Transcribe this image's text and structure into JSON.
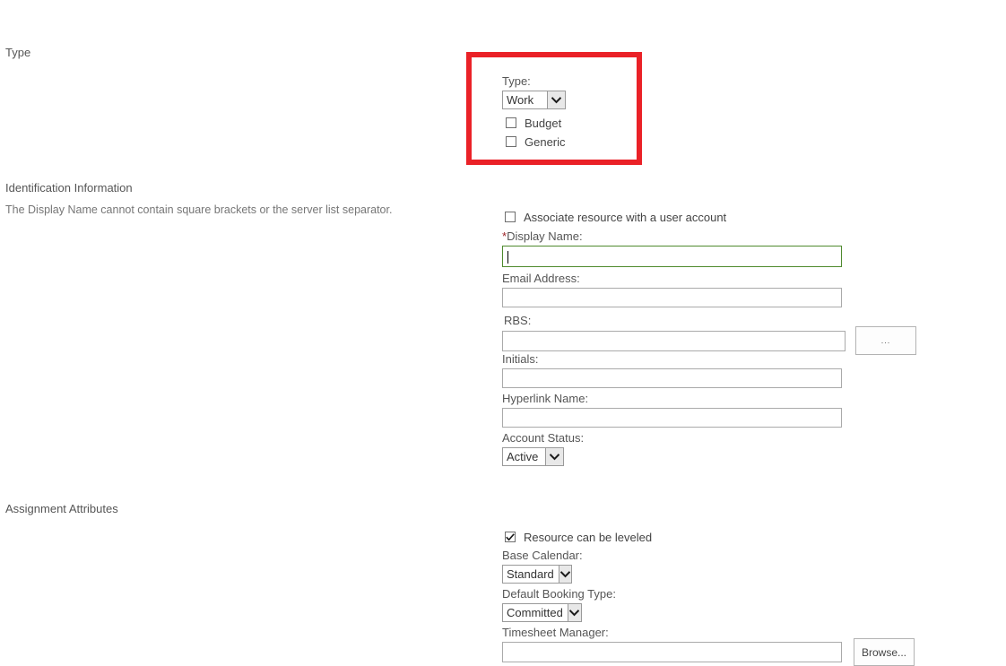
{
  "sections": {
    "type": {
      "heading": "Type",
      "fields": {
        "type_label": "Type:",
        "type_value": "Work",
        "budget_label": "Budget",
        "budget_checked": false,
        "generic_label": "Generic",
        "generic_checked": false
      }
    },
    "identification": {
      "heading": "Identification Information",
      "hint": "The Display Name cannot contain square brackets or the server list separator.",
      "fields": {
        "associate_label": "Associate resource with a user account",
        "associate_checked": false,
        "display_name_label": "Display Name:",
        "display_name_required_marker": "*",
        "display_name_value": "",
        "email_label": "Email Address:",
        "email_value": "",
        "rbs_label": "RBS:",
        "rbs_value": "",
        "rbs_browse_label": "...",
        "initials_label": "Initials:",
        "initials_value": "",
        "hyperlink_label": "Hyperlink Name:",
        "hyperlink_value": "",
        "account_status_label": "Account Status:",
        "account_status_value": "Active"
      }
    },
    "assignment": {
      "heading": "Assignment Attributes",
      "fields": {
        "leveled_label": "Resource can be leveled",
        "leveled_checked": true,
        "base_calendar_label": "Base Calendar:",
        "base_calendar_value": "Standard",
        "booking_type_label": "Default Booking Type:",
        "booking_type_value": "Committed",
        "timesheet_manager_label": "Timesheet Manager:",
        "timesheet_manager_value": "",
        "timesheet_browse_label": "Browse..."
      }
    }
  },
  "annotation": {
    "highlight_color": "#ea2127",
    "highlight_target": "type-field-group"
  }
}
